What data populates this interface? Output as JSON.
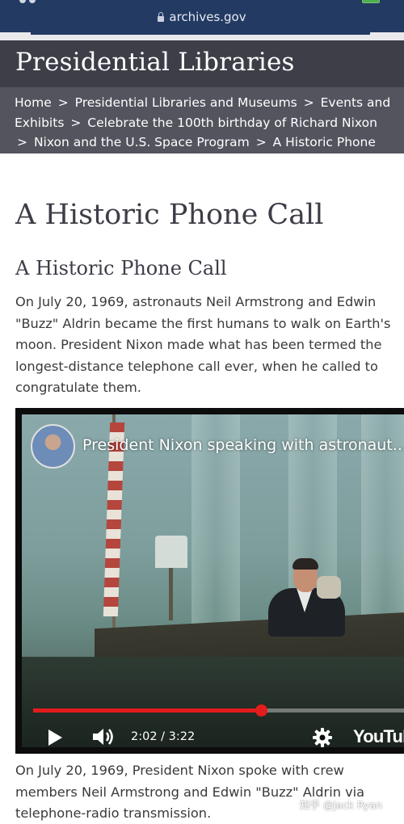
{
  "browser": {
    "url": "archives.gov",
    "icon": "lock-icon"
  },
  "site": {
    "title": "Presidential Libraries"
  },
  "breadcrumb": {
    "items": [
      "Home",
      "Presidential Libraries and Museums",
      "Events and Exhibits",
      "Celebrate the 100th birthday of Richard Nixon",
      "Nixon and the U.S. Space Program",
      "A Historic Phone Call"
    ],
    "separator": ">"
  },
  "page": {
    "title": "A Historic Phone Call",
    "section_title": "A Historic Phone Call",
    "intro": "On July 20, 1969, astronauts Neil Armstrong and Edwin \"Buzz\" Aldrin became the first humans to walk on Earth's moon. President Nixon made what has been termed the longest-distance telephone call ever, when he called to congratulate them.",
    "caption": "On July 20, 1969, President Nixon spoke with crew members Neil Armstrong and Edwin \"Buzz\" Aldrin via telephone-radio transmission."
  },
  "video": {
    "title": "President Nixon speaking with astronaut...",
    "current_time": "2:02",
    "duration": "3:22",
    "time_display": "2:02 / 3:22",
    "progress_fraction": 0.604,
    "logo": "YouTube",
    "colors": {
      "progress": "#e31c1c"
    },
    "icons": [
      "play-icon",
      "volume-icon",
      "gear-icon"
    ]
  },
  "watermark": "知乎 @Jack Ryan"
}
